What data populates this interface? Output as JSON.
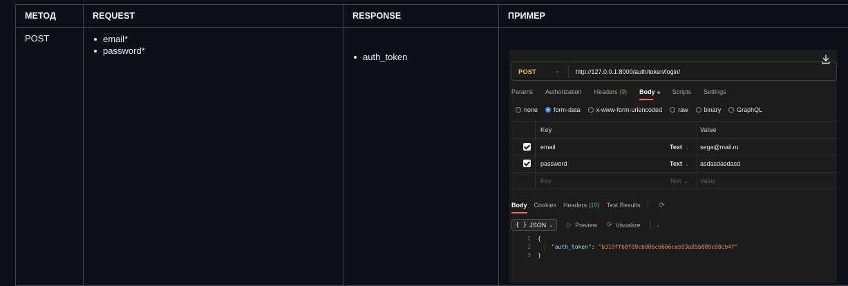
{
  "table": {
    "headers": [
      "МЕТОД",
      "REQUEST",
      "RESPONSE",
      "ПРИМЕР"
    ],
    "row": {
      "method": "POST",
      "request_fields": [
        "email*",
        "password*"
      ],
      "response_fields": [
        "auth_token"
      ]
    }
  },
  "postman": {
    "method": "POST",
    "url": "http://127.0.0.1:8000/auth/token/login/",
    "request_tabs": [
      {
        "label": "Params"
      },
      {
        "label": "Authorization"
      },
      {
        "label": "Headers",
        "count": "(9)"
      },
      {
        "label": "Body",
        "active": true
      },
      {
        "label": "Scripts"
      },
      {
        "label": "Settings"
      }
    ],
    "body_types": [
      "none",
      "form-data",
      "x-www-form-urlencoded",
      "raw",
      "binary",
      "GraphQL"
    ],
    "body_type_selected": "form-data",
    "form_table": {
      "key_header": "Key",
      "value_header": "Value",
      "rows": [
        {
          "checked": true,
          "key": "email",
          "type": "Text",
          "value": "sega@mail.ru"
        },
        {
          "checked": true,
          "key": "password",
          "type": "Text",
          "value": "asdasdasdasd"
        }
      ],
      "placeholder": {
        "key": "Key",
        "type": "Text",
        "value": "Value"
      }
    },
    "response_tabs": [
      {
        "label": "Body",
        "active": true
      },
      {
        "label": "Cookies"
      },
      {
        "label": "Headers",
        "count": "(10)"
      },
      {
        "label": "Test Results"
      }
    ],
    "format": {
      "braces": "{ }",
      "label": "JSON",
      "preview": "Preview",
      "visualize": "Visualize"
    },
    "response_code": {
      "line_numbers": [
        "1",
        "2",
        "3"
      ],
      "open": "{",
      "key": "\"auth_token\"",
      "colon": ": ",
      "value": "\"b319ffb8f09cb086c6666ceb93a85b889c08cb4f\"",
      "close": "}"
    },
    "colors": {
      "method": "#f5c04a",
      "active_underline": "#ff6c37",
      "count": "#4bb36b",
      "radio_selected": "#3e8ef7"
    }
  }
}
